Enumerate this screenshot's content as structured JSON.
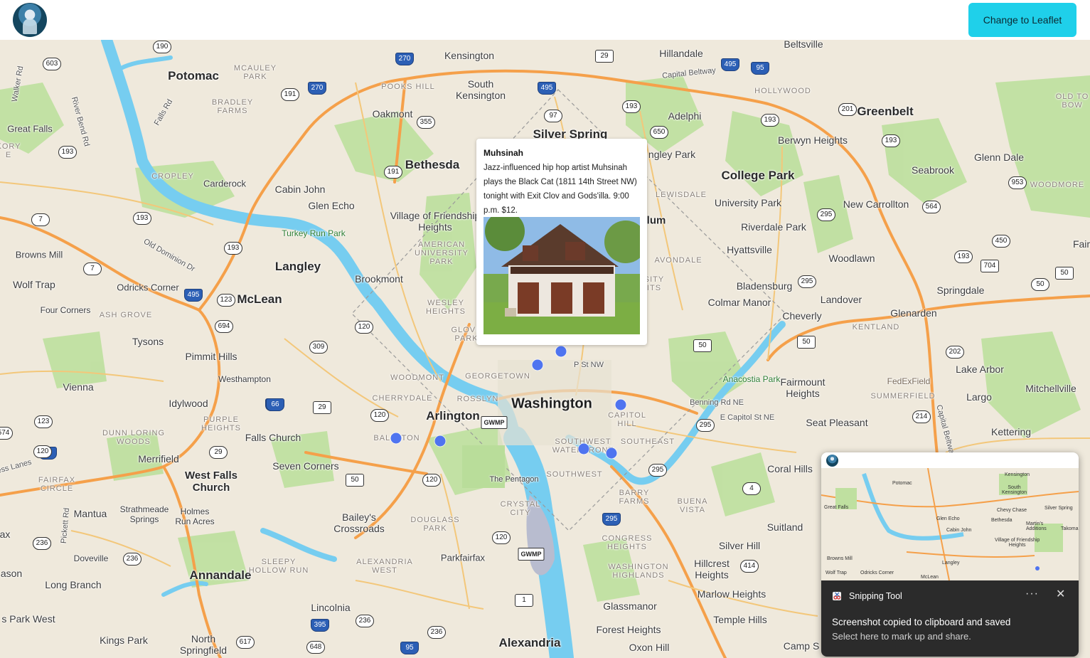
{
  "header": {
    "button_label": "Change to Leaflet"
  },
  "map": {
    "places": {
      "potomac": "Potomac",
      "bethesda": "Bethesda",
      "kensington": "Kensington",
      "south_kensington": "South\nKensington",
      "silver_spring": "Silver Spring",
      "chevy_chase": "Chevy Chase",
      "hillandale": "Hillandale",
      "adelphi": "Adelphi",
      "beltsville": "Beltsville",
      "greenbelt": "Greenbelt",
      "berwyn_heights": "Berwyn Heights",
      "college_park": "College Park",
      "university_park": "University Park",
      "riverdale_park": "Riverdale Park",
      "hyattsville": "Hyattsville",
      "new_carrollton": "New Carrollton",
      "seabrook": "Seabrook",
      "glenn_dale": "Glenn Dale",
      "woodlawn": "Woodlawn",
      "bladensburg": "Bladensburg",
      "landover": "Landover",
      "springdale": "Springdale",
      "colmar_manor": "Colmar Manor",
      "cheverly": "Cheverly",
      "glenarden": "Glenarden",
      "fairmount_heights": "Fairmount\nHeights",
      "lake_arbor": "Lake Arbor",
      "mitchellville": "Mitchellville",
      "largo": "Largo",
      "seat_pleasant": "Seat Pleasant",
      "kettering": "Kettering",
      "coral_hills": "Coral Hills",
      "suitland": "Suitland",
      "silver_hill": "Silver Hill",
      "hillcrest_heights": "Hillcrest\nHeights",
      "marlow_heights": "Marlow Heights",
      "temple_hills": "Temple Hills",
      "glassmanor": "Glassmanor",
      "forest_heights": "Forest Heights",
      "oxon_hill": "Oxon Hill",
      "camp_springs": "Camp S",
      "alexandria": "Alexandria",
      "washington": "Washington",
      "arlington": "Arlington",
      "the_pentagon": "The Pentagon",
      "parkfairfax": "Parkfairfax",
      "baileys_crossroads": "Bailey's\nCrossroads",
      "seven_corners": "Seven Corners",
      "falls_church": "Falls Church",
      "west_falls_church": "West Falls\nChurch",
      "merrifield": "Merrifield",
      "mantua": "Mantua",
      "annandale": "Annandale",
      "lincolnia": "Lincolnia",
      "north_springfield": "North\nSpringfield",
      "kings_park": "Kings Park",
      "long_branch": "Long Branch",
      "doveville": "Doveville",
      "vienna": "Vienna",
      "idylwood": "Idylwood",
      "pimmit_hills": "Pimmit Hills",
      "tysons": "Tysons",
      "mclean": "McLean",
      "langley": "Langley",
      "westhampton": "Westhampton",
      "four_corners": "Four Corners",
      "wolf_trap": "Wolf Trap",
      "odricks_corner": "Odricks Corner",
      "browns_mill": "Browns Mill",
      "great_falls": "Great Falls",
      "carderock": "Carderock",
      "cabin_john": "Cabin John",
      "glen_echo": "Glen Echo",
      "village_of_friendship": "Village of Friendship\nHeights",
      "brookmont": "Brookmont",
      "oakmont": "Oakmont",
      "strathmeade_springs": "Strathmeade\nSprings",
      "holmes_run_acres": "Holmes\nRun Acres",
      "park_west": "s Park West",
      "ax": "ax",
      "ason": "ason",
      "langley_park": "ngley Park",
      "lum": "lum",
      "fair": "Fair"
    },
    "districts": {
      "georgetown": "GEORGETOWN",
      "woodmont": "WOODMONT",
      "cherrydale": "CHERRYDALE",
      "rosslyn": "ROSSLYN",
      "ballston": "BALLSTON",
      "capitol_hill": "CAPITOL\nHILL",
      "southeast": "SOUTHEAST",
      "southwest": "SOUTHWEST",
      "sw_waterfront": "SOUTHWEST\nWATERFRONT",
      "crystal_city": "CRYSTAL\nCITY",
      "douglass_park": "DOUGLASS\nPARK",
      "alexandria_west": "ALEXANDRIA\nWEST",
      "sleepy_hollow_run": "SLEEPY\nHOLLOW RUN",
      "barry_farms": "BARRY\nFARMS",
      "buena_vista": "BUENA\nVISTA",
      "congress_heights": "CONGRESS\nHEIGHTS",
      "washington_highlands": "WASHINGTON\nHIGHLANDS",
      "mcauley_park": "MCAULEY\nPARK",
      "bradley_farms": "BRADLEY\nFARMS",
      "pooks_hill": "POOKS HILL",
      "hollywood": "HOLLYWOOD",
      "lewisdale": "LEWISDALE",
      "avondale": "AVONDALE",
      "kentland": "KENTLAND",
      "summerfield": "SUMMERFIELD",
      "woodmore": "WOODMORE",
      "croply": "CROPLEY",
      "american_university": "AMERICAN\nUNIVERSITY\nPARK",
      "wesley_heights": "WESLEY\nHEIGHTS",
      "glover_park": "GLOVE\nPARK",
      "ash_grove": "ASH GROVE",
      "dunn_loring_woods": "DUNN LORING\nWOODS",
      "purple_heights": "PURPLE\nHEIGHTS",
      "fairfax_circle": "FAIRFAX\nCIRCLE",
      "old_town_bowie": "OLD TO\nBOW",
      "sity_its": "SITY\nITS",
      "kory": "KORY\nE"
    },
    "parks": {
      "turkey_run": "Turkey Run Park",
      "anacostia": "Anacostia Park",
      "fedexfield": "FedExField"
    },
    "roads": {
      "p_st_nw": "P St NW",
      "benning_rd": "Benning Rd NE",
      "e_capitol": "E Capitol St NE",
      "capital_beltway": "Capital Beltway",
      "capital_beltway_2": "Capital Beltway",
      "falls_rd": "Falls Rd",
      "river_bend": "River Bend Rd",
      "walker_rd": "Walker Rd",
      "old_dominion": "Old Dominion Dr",
      "pickett_rd": "Pickett Rd",
      "ess_lanes": "ess Lanes"
    },
    "shields": [
      "190",
      "603",
      "270",
      "270",
      "495",
      "29",
      "97",
      "193",
      "650",
      "495",
      "95",
      "193",
      "201",
      "193",
      "191",
      "355",
      "191",
      "193",
      "7",
      "193",
      "193",
      "7",
      "495",
      "123",
      "694",
      "309",
      "120",
      "120",
      "66",
      "29",
      "120",
      "495",
      "50",
      "295",
      "50",
      "50",
      "193",
      "704",
      "50",
      "564",
      "953",
      "450",
      "202",
      "214",
      "295",
      "295",
      "4",
      "414",
      "295",
      "66",
      "29",
      "50",
      "120",
      "120",
      "236",
      "236",
      "395",
      "236",
      "236",
      "617",
      "648",
      "95",
      "1",
      "GWMP",
      "GWMP",
      "123",
      "574",
      "236",
      "201",
      "295"
    ]
  },
  "popup": {
    "title": "Muhsinah",
    "description": "Jazz-influenced hip hop artist Muhsinah plays the Black Cat (1811 14th Street NW) tonight with Exit Clov and Gods'illa. 9:00 p.m. $12."
  },
  "toast": {
    "app_name": "Snipping Tool",
    "message": "Screenshot copied to clipboard and saved",
    "sub_message": "Select here to mark up and share.",
    "more_label": "···",
    "close_label": "✕",
    "preview_labels": [
      "Potomac",
      "Kensington",
      "South\nKensington",
      "Silver Spring",
      "Bethesda",
      "Cabin John",
      "Martin's\nAdditions",
      "Village of Friendship\nHeights",
      "Langley",
      "McLean",
      "Chevy Chase",
      "Takoma",
      "Wolf Trap",
      "Odricks Corner",
      "Browns Mill",
      "Great Falls",
      "Glen Echo"
    ]
  },
  "colors": {
    "accent": "#1fd0ea",
    "marker": "#4f74f0",
    "water": "#76cdf0",
    "park": "#b9dd9a",
    "highway": "#f5a04a"
  }
}
